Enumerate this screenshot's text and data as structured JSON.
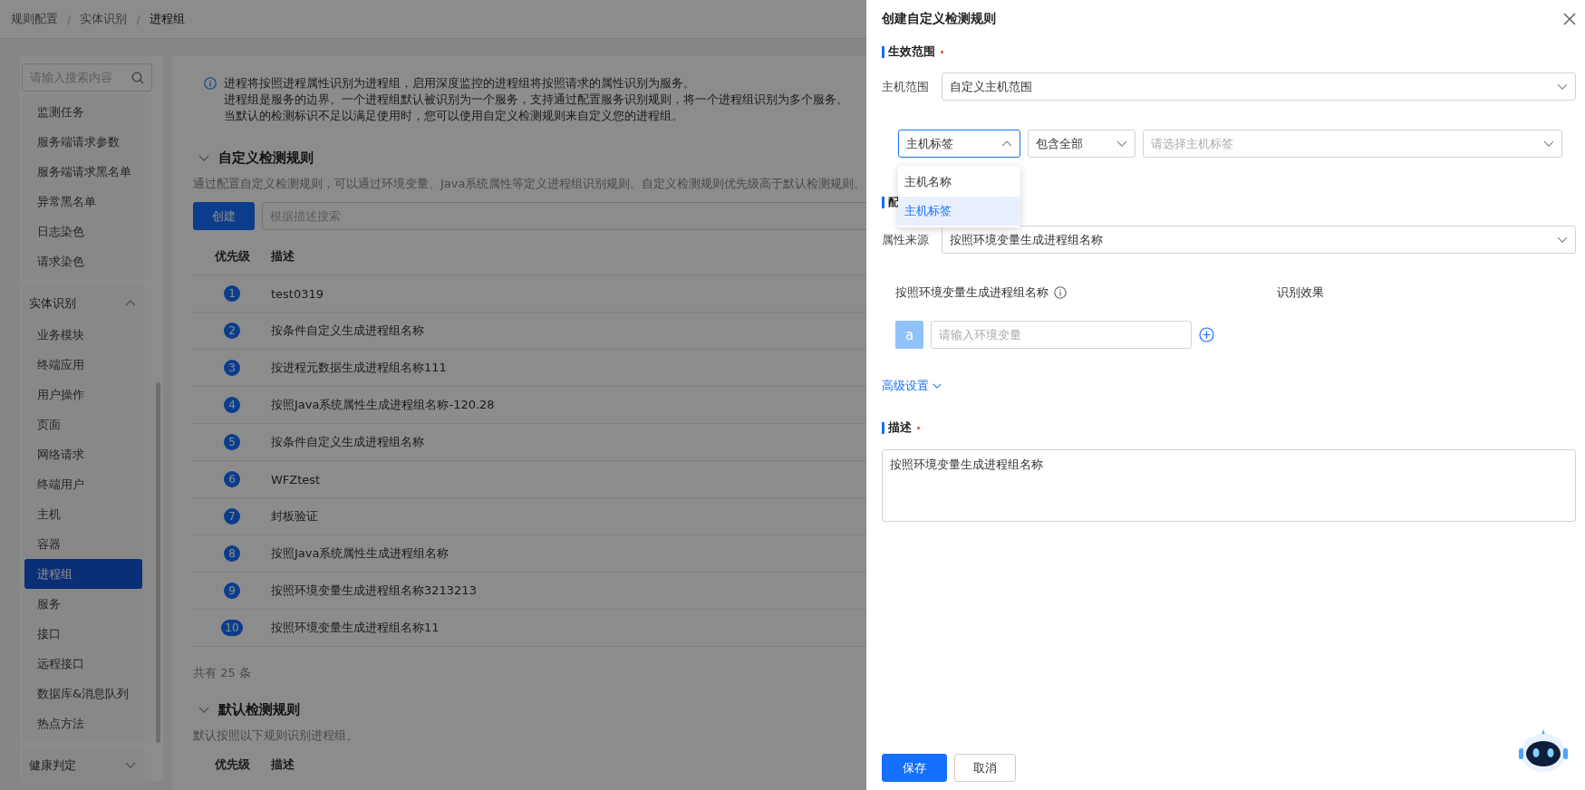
{
  "breadcrumb": [
    "规则配置",
    "实体识别",
    "进程组"
  ],
  "breadcrumb_separator": "/",
  "sidebar": {
    "search_placeholder": "请输入搜索内容",
    "groups": [
      {
        "items": [
          {
            "label": "监测任务",
            "selected": false
          },
          {
            "label": "服务端请求参数",
            "selected": false
          },
          {
            "label": "服务端请求黑名单",
            "selected": false
          },
          {
            "label": "异常黑名单",
            "selected": false
          },
          {
            "label": "日志染色",
            "selected": false
          },
          {
            "label": "请求染色",
            "selected": false
          }
        ]
      },
      {
        "title": "实体识别",
        "expanded": true,
        "items": [
          {
            "label": "业务模块",
            "selected": false
          },
          {
            "label": "终端应用",
            "selected": false
          },
          {
            "label": "用户操作",
            "selected": false
          },
          {
            "label": "页面",
            "selected": false
          },
          {
            "label": "网络请求",
            "selected": false
          },
          {
            "label": "终端用户",
            "selected": false
          },
          {
            "label": "主机",
            "selected": false
          },
          {
            "label": "容器",
            "selected": false
          },
          {
            "label": "进程组",
            "selected": true
          },
          {
            "label": "服务",
            "selected": false
          },
          {
            "label": "接口",
            "selected": false
          },
          {
            "label": "远程接口",
            "selected": false
          },
          {
            "label": "数据库&消息队列",
            "selected": false
          },
          {
            "label": "热点方法",
            "selected": false
          }
        ]
      },
      {
        "title": "健康判定",
        "expanded": false
      }
    ]
  },
  "info": [
    "进程将按照进程属性识别为进程组，启用深度监控的进程组将按照请求的属性识别为服务。",
    "进程组是服务的边界。一个进程组默认被识别为一个服务，支持通过配置服务识别规则，将一个进程组识别为多个服务。",
    "当默认的检测标识不足以满足使用时，您可以使用自定义检测规则来自定义您的进程组。"
  ],
  "custom_rules": {
    "title": "自定义检测规则",
    "expanded": true,
    "description": "通过配置自定义检测规则，可以通过环境变量、Java系统属性等定义进程组识别规则。自定义检测规则优先级高于默认检测规则。",
    "create_button": "创建",
    "search_placeholder": "根据描述搜索",
    "columns": [
      "优先级",
      "描述"
    ],
    "rows": [
      {
        "priority": "1",
        "description": "test0319"
      },
      {
        "priority": "2",
        "description": "按条件自定义生成进程组名称"
      },
      {
        "priority": "3",
        "description": "按进程元数据生成进程组名称111"
      },
      {
        "priority": "4",
        "description": "按照Java系统属性生成进程组名称-120.28"
      },
      {
        "priority": "5",
        "description": "按条件自定义生成进程组名称"
      },
      {
        "priority": "6",
        "description": "WFZtest"
      },
      {
        "priority": "7",
        "description": "封板验证"
      },
      {
        "priority": "8",
        "description": "按照Java系统属性生成进程组名称"
      },
      {
        "priority": "9",
        "description": "按照环境变量生成进程组名称3213213"
      },
      {
        "priority": "10",
        "description": "按照环境变量生成进程组名称11"
      }
    ],
    "total": "共有 25 条"
  },
  "default_rules": {
    "title": "默认检测规则",
    "expanded": true,
    "description": "默认按照以下规则识别进程组。",
    "columns": [
      "优先级",
      "描述"
    ]
  },
  "drawer": {
    "title": "创建自定义检测规则",
    "scope": {
      "title": "生效范围",
      "required": true,
      "host_range_label": "主机范围",
      "host_range_value": "自定义主机范围",
      "condition": {
        "field": "主机标签",
        "open": true,
        "options": [
          {
            "label": "主机名称",
            "selected": false
          },
          {
            "label": "主机标签",
            "selected": true
          }
        ],
        "operator": "包含全部",
        "value_placeholder": "请选择主机标签"
      }
    },
    "config": {
      "title": "配",
      "source_label": "属性来源",
      "source_value": "按照环境变量生成进程组名称",
      "env_label": "按照环境变量生成进程组名称",
      "effect_label": "识别效果",
      "var_badge": "a",
      "var_placeholder": "请输入环境变量",
      "advanced": "高级设置"
    },
    "desc": {
      "title": "描述",
      "required": true,
      "value": "按照环境变量生成进程组名称"
    },
    "buttons": {
      "save": "保存",
      "cancel": "取消"
    }
  }
}
